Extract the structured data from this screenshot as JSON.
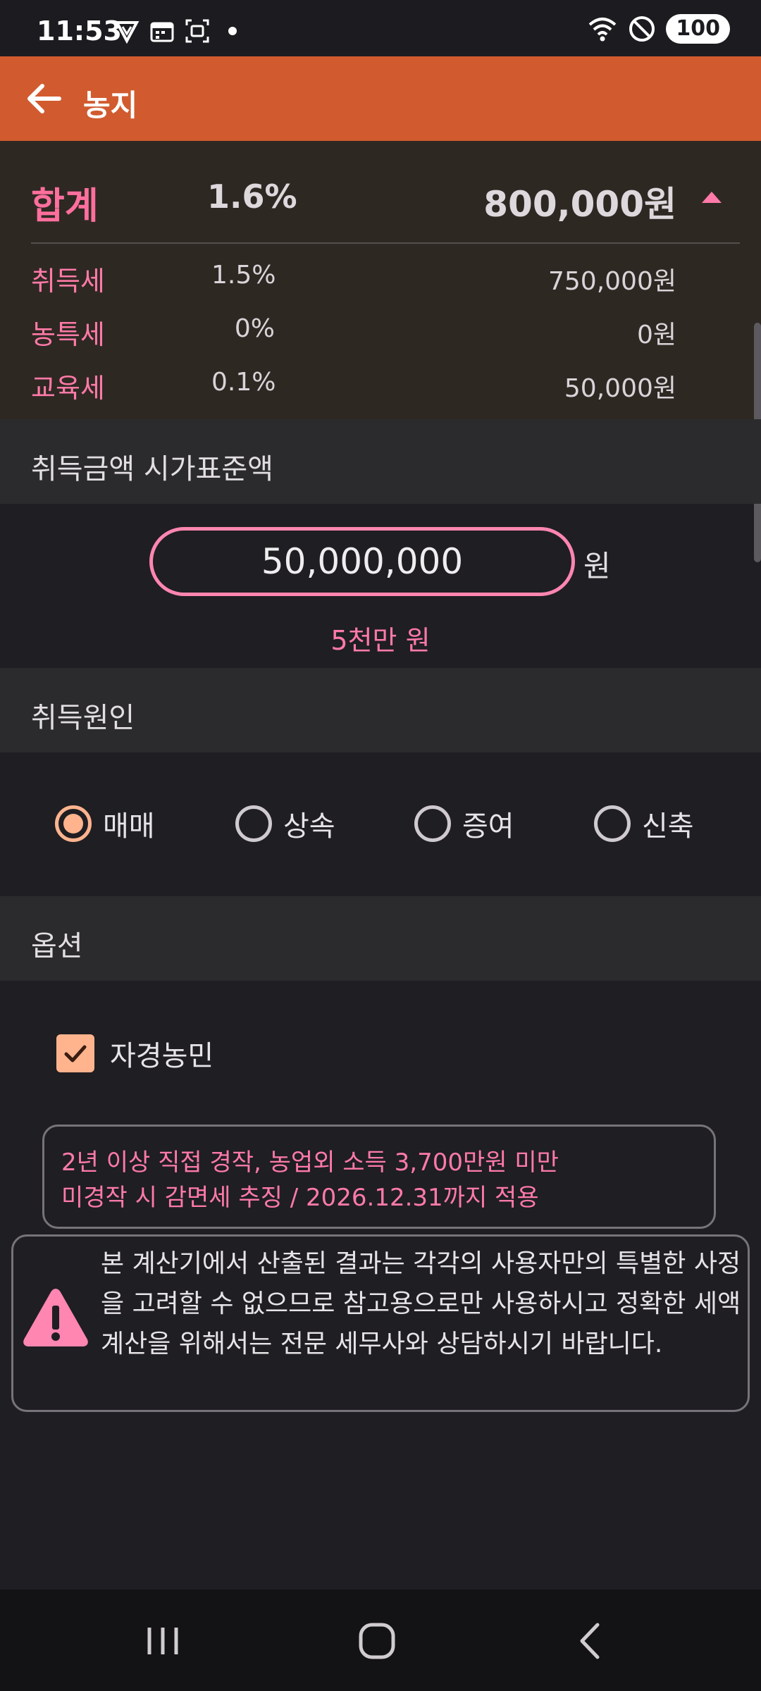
{
  "status_bar": {
    "time": "11:53",
    "battery": "100",
    "left_icons": [
      "shield-v-icon",
      "calendar-icon",
      "screenshot-icon",
      "dot-icon"
    ],
    "right_icons": [
      "wifi-icon",
      "do-not-disturb-icon"
    ]
  },
  "app_bar": {
    "title": "농지",
    "back_icon": "arrow-left-icon",
    "color": "#d15b2f"
  },
  "summary": {
    "total": {
      "label": "합계",
      "rate": "1.6%",
      "amount": "800,000원"
    },
    "rows": [
      {
        "label": "취득세",
        "rate": "1.5%",
        "amount": "750,000원"
      },
      {
        "label": "농특세",
        "rate": "0%",
        "amount": "0원"
      },
      {
        "label": "교육세",
        "rate": "0.1%",
        "amount": "50,000원"
      }
    ],
    "expanded": true
  },
  "acquisition_amount": {
    "header": "취득금액 시가표준액",
    "value": "50,000,000",
    "unit": "원",
    "korean_reading": "5천만 원"
  },
  "acquisition_cause": {
    "header": "취득원인",
    "options": [
      "매매",
      "상속",
      "증여",
      "신축"
    ],
    "selected": "매매"
  },
  "options": {
    "header": "옵션",
    "checkbox_label": "자경농민",
    "checked": true,
    "note_line1": "2년 이상 직접 경작, 농업외 소득 3,700만원 미만",
    "note_line2": "미경작 시 감면세 추징 / 2026.12.31까지 적용"
  },
  "disclaimer": {
    "icon": "warning-icon",
    "text": "본 계산기에서 산출된 결과는 각각의 사용자만의 특별한 사정을 고려할 수 없으므로 참고용으로만 사용하시고 정확한 세액계산을 위해서는 전문 세무사와 상담하시기 바랍니다."
  },
  "colors": {
    "accent_pink": "#ff7aa8",
    "accent_peach": "#ffb48e",
    "background": "#1f1e22"
  }
}
